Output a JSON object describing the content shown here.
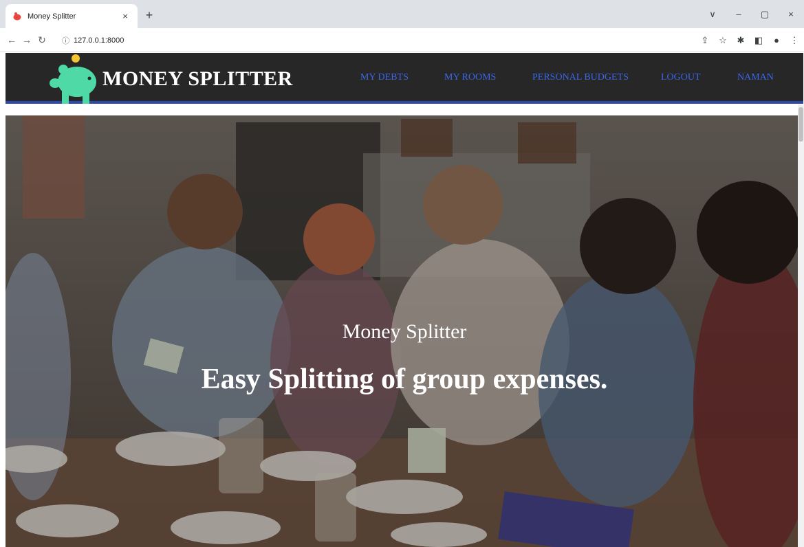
{
  "browser": {
    "tab_title": "Money Splitter",
    "tab_close": "×",
    "new_tab": "+",
    "address": "127.0.0.1:8000",
    "window_controls": [
      "∨",
      "–",
      "▢",
      "×"
    ]
  },
  "header": {
    "brand": "MONEY SPLITTER",
    "nav": [
      {
        "label": "MY DEBTS"
      },
      {
        "label": "MY ROOMS"
      },
      {
        "label": "PERSONAL BUDGETS"
      },
      {
        "label": "LOGOUT"
      },
      {
        "label": "NAMAN"
      }
    ]
  },
  "hero": {
    "subtitle": "Money Splitter",
    "title": "Easy Splitting of group expenses."
  },
  "colors": {
    "header_bg": "#272727",
    "nav_link": "#3b67e8",
    "header_border": "#2d4aa8",
    "logo_green": "#4fd9a6",
    "logo_coin": "#f6c431"
  }
}
